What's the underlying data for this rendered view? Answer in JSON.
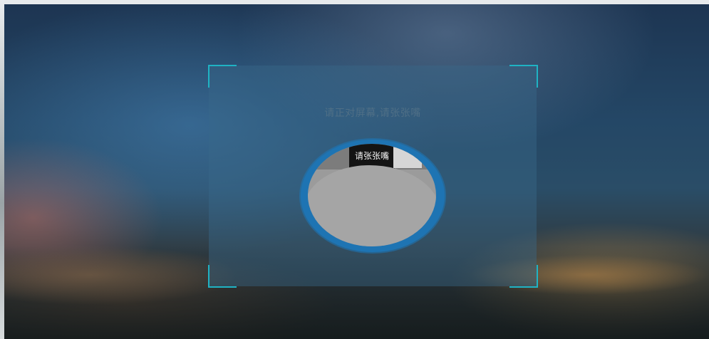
{
  "face_check": {
    "instruction": "请正对屏幕,请张张嘴",
    "camera_prompt": "请张张嘴"
  },
  "colors": {
    "frame_corner": "#1fb3c4",
    "camera_ring": "#1e74b3",
    "panel_overlay": "#3a6a8a",
    "instruction_text": "#4f6f86"
  }
}
